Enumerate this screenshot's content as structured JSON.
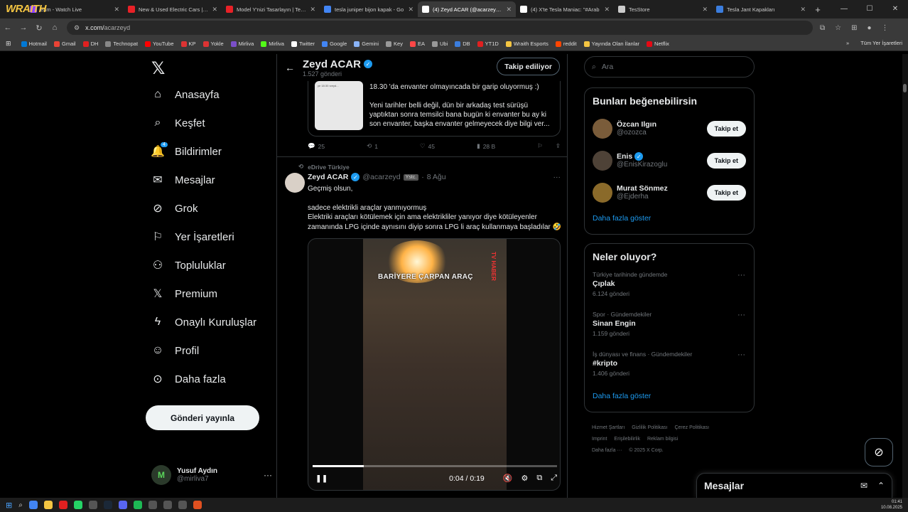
{
  "browser": {
    "wraith_logo": "WRAITH",
    "tabs": [
      {
        "title": "eam - Watch Live",
        "color": "#9146ff",
        "active": false
      },
      {
        "title": "New & Used Electric Cars | Te",
        "color": "#e82127",
        "active": false
      },
      {
        "title": "Model Y'nizi Tasarlayın | Tesla",
        "color": "#e82127",
        "active": false
      },
      {
        "title": "tesla juniper bijon kapak - Go",
        "color": "#4285f4",
        "active": false
      },
      {
        "title": "(4) Zeyd ACAR (@acarzeyd) /",
        "color": "#ffffff",
        "active": true
      },
      {
        "title": "(4) X'te Tesla Maniac: \"#Arab",
        "color": "#ffffff",
        "active": false
      },
      {
        "title": "TesStore",
        "color": "#cccccc",
        "active": false
      },
      {
        "title": "Tesla Jant Kapakları",
        "color": "#3b7ddd",
        "active": false
      }
    ],
    "new_tab": "+",
    "url_domain": "x.com/",
    "url_path": "acarzeyd",
    "bookmarks": [
      {
        "label": "Hotmail",
        "color": "#0078d4"
      },
      {
        "label": "Gmail",
        "color": "#ea4335"
      },
      {
        "label": "DH",
        "color": "#e02020"
      },
      {
        "label": "Technopat",
        "color": "#888888"
      },
      {
        "label": "YouTube",
        "color": "#ff0000"
      },
      {
        "label": "KP",
        "color": "#d33"
      },
      {
        "label": "Yokle",
        "color": "#d33"
      },
      {
        "label": "Mirliva",
        "color": "#7b4fc9"
      },
      {
        "label": "Mirliva",
        "color": "#53fc18"
      },
      {
        "label": "Twitter",
        "color": "#ffffff"
      },
      {
        "label": "Google",
        "color": "#4285f4"
      },
      {
        "label": "Gemini",
        "color": "#8ab4f8"
      },
      {
        "label": "Key",
        "color": "#999999"
      },
      {
        "label": "EA",
        "color": "#ff4747"
      },
      {
        "label": "Ubi",
        "color": "#999999"
      },
      {
        "label": "DB",
        "color": "#3b7ddd"
      },
      {
        "label": "YT1D",
        "color": "#e02020"
      },
      {
        "label": "Wraith Esports",
        "color": "#f4c542"
      },
      {
        "label": "reddit",
        "color": "#ff4500"
      },
      {
        "label": "Yayında Olan İlanlar",
        "color": "#f4c542"
      },
      {
        "label": "Netflix",
        "color": "#e50914"
      }
    ],
    "all_bookmarks": "Tüm Yer İşaretleri"
  },
  "nav": {
    "items": [
      {
        "label": "Anasayfa",
        "icon": "home-icon"
      },
      {
        "label": "Keşfet",
        "icon": "search-icon"
      },
      {
        "label": "Bildirimler",
        "icon": "bell-icon",
        "badge": "4"
      },
      {
        "label": "Mesajlar",
        "icon": "mail-icon"
      },
      {
        "label": "Grok",
        "icon": "grok-icon"
      },
      {
        "label": "Yer İşaretleri",
        "icon": "bookmark-icon"
      },
      {
        "label": "Topluluklar",
        "icon": "community-icon"
      },
      {
        "label": "Premium",
        "icon": "x-premium-icon"
      },
      {
        "label": "Onaylı Kuruluşlar",
        "icon": "lightning-icon"
      },
      {
        "label": "Profil",
        "icon": "profile-icon"
      },
      {
        "label": "Daha fazla",
        "icon": "more-circle-icon"
      }
    ],
    "post_button": "Gönderi yayınla",
    "me": {
      "name": "Yusuf Aydın",
      "handle": "@mirliva7",
      "more": "···"
    }
  },
  "header": {
    "name": "Zeyd ACAR",
    "posts": "1.527 gönderi",
    "follow": "Takip ediliyor"
  },
  "quote": {
    "text1": "18.30 'da envanter olmayıncada bir garip oluyormuş :)",
    "text2": "Yeni tarihler belli değil, dün bir arkadaş test sürüşü yaptıktan sonra temsilci bana bugün ki envanter bu ay ki son envanter, başka envanter gelmeyecek diye bilgi ver...",
    "img_text": "ye 18:30 rzeyd..."
  },
  "actions1": {
    "reply": "25",
    "repost": "1",
    "like": "45",
    "views": "28 B"
  },
  "post": {
    "reposted_by": "eDrive Türkiye",
    "name": "Zeyd ACAR",
    "handle": "@acarzeyd",
    "tag": "Ystc.",
    "date": "8 Ağu",
    "dots": "···",
    "line1": "Geçmiş olsun,",
    "line2": "sadece elektrikli araçlar yanmıyormuş",
    "line3": "Elektriki araçları kötülemek için ama elektrikliler yanıyor diye kötüleyenler zamanında LPG içinde aynısını diyip sonra LPG li araç kullanmaya başladılar 🤣",
    "video_caption": "BARİYERE ÇARPAN ARAÇ",
    "video_tag": "TV HABER",
    "time": "0:04 / 0:19",
    "progress": 0.21
  },
  "search": {
    "placeholder": "Ara"
  },
  "who": {
    "title": "Bunları beğenebilirsin",
    "users": [
      {
        "name": "Özcan Ilgın",
        "handle": "@ozozca",
        "verified": false,
        "btn": "Takip et"
      },
      {
        "name": "Enis",
        "handle": "@EnisKirazoglu",
        "verified": true,
        "btn": "Takip et"
      },
      {
        "name": "Murat Sönmez",
        "handle": "@Ejderha",
        "verified": false,
        "btn": "Takip et"
      }
    ],
    "more": "Daha fazla göster"
  },
  "trends": {
    "title": "Neler oluyor?",
    "items": [
      {
        "cat": "Türkiye tarihinde gündemde",
        "title": "Çıplak",
        "count": "6.124 gönderi"
      },
      {
        "cat": "Spor · Gündemdekiler",
        "title": "Sinan Engin",
        "count": "1.159 gönderi"
      },
      {
        "cat": "İş dünyası ve finans · Gündemdekiler",
        "title": "#kripto",
        "count": "1.406 gönderi"
      }
    ],
    "more": "Daha fazla göster"
  },
  "footer": {
    "l1": [
      "Hizmet Şartları",
      "Gizlilik Politikası",
      "Çerez Politikası"
    ],
    "l2": [
      "Imprint",
      "Erişilebilirlik",
      "Reklam bilgisi"
    ],
    "l3": [
      "Daha fazla ···",
      "© 2025 X Corp."
    ]
  },
  "dock": {
    "title": "Mesajlar"
  },
  "tray": {
    "time": "01:41",
    "date": "10.08.2025"
  }
}
